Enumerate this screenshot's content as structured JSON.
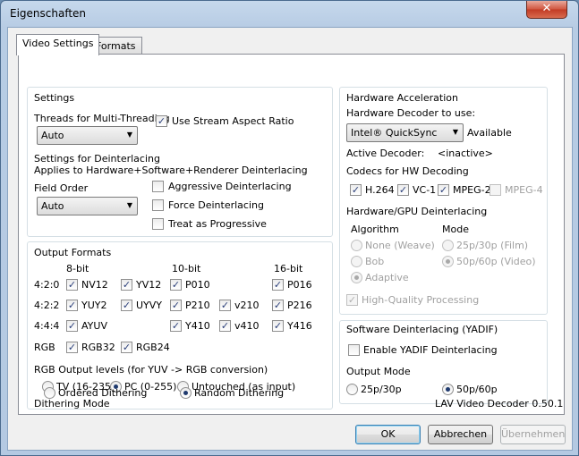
{
  "window": {
    "title": "Eigenschaften",
    "close_label": "✕"
  },
  "tabs": {
    "video": "Video Settings",
    "formats": "Formats"
  },
  "settings": {
    "group": "Settings",
    "threads_label": "Threads for Multi-Threading",
    "threads_value": "Auto",
    "stream_aspect": "Use Stream Aspect Ratio",
    "deint_title": "Settings for Deinterlacing",
    "deint_sub": "Applies to Hardware+Software+Renderer Deinterlacing",
    "field_order_label": "Field Order",
    "field_order_value": "Auto",
    "aggressive": "Aggressive Deinterlacing",
    "force": "Force Deinterlacing",
    "progressive": "Treat as Progressive"
  },
  "output": {
    "group": "Output Formats",
    "h8": "8-bit",
    "h10": "10-bit",
    "h16": "16-bit",
    "r420": "4:2:0",
    "r422": "4:2:2",
    "r444": "4:4:4",
    "rrgb": "RGB",
    "nv12": "NV12",
    "yv12": "YV12",
    "p010": "P010",
    "p016": "P016",
    "yuy2": "YUY2",
    "uyvy": "UYVY",
    "p210": "P210",
    "v210": "v210",
    "p216": "P216",
    "ayuv": "AYUV",
    "y410": "Y410",
    "v410": "v410",
    "y416": "Y416",
    "rgb32": "RGB32",
    "rgb24": "RGB24",
    "levels_label": "RGB Output levels (for YUV -> RGB conversion)",
    "tv": "TV (16-235)",
    "pc": "PC (0-255)",
    "untouched": "Untouched (as input)",
    "dither_label": "Dithering Mode",
    "ordered": "Ordered Dithering",
    "random": "Random Dithering"
  },
  "hw": {
    "group": "Hardware Acceleration",
    "decoder_label": "Hardware Decoder to use:",
    "decoder_value": "Intel® QuickSync",
    "available": "Available",
    "active_label": "Active Decoder:",
    "active_value": "<inactive>",
    "codecs_label": "Codecs for HW Decoding",
    "h264": "H.264",
    "vc1": "VC-1",
    "mpeg2": "MPEG-2",
    "mpeg4": "MPEG-4",
    "gpu_label": "Hardware/GPU Deinterlacing",
    "algo_label": "Algorithm",
    "mode_label": "Mode",
    "none": "None (Weave)",
    "bob": "Bob",
    "adaptive": "Adaptive",
    "film": "25p/30p (Film)",
    "video": "50p/60p (Video)",
    "hq": "High-Quality Processing"
  },
  "sw": {
    "group": "Software Deinterlacing (YADIF)",
    "enable": "Enable YADIF Deinterlacing",
    "mode_label": "Output Mode",
    "p25": "25p/30p",
    "p50": "50p/60p"
  },
  "version": "LAV Video Decoder 0.50.1",
  "buttons": {
    "ok": "OK",
    "cancel": "Abbrechen",
    "apply": "Übernehmen"
  }
}
